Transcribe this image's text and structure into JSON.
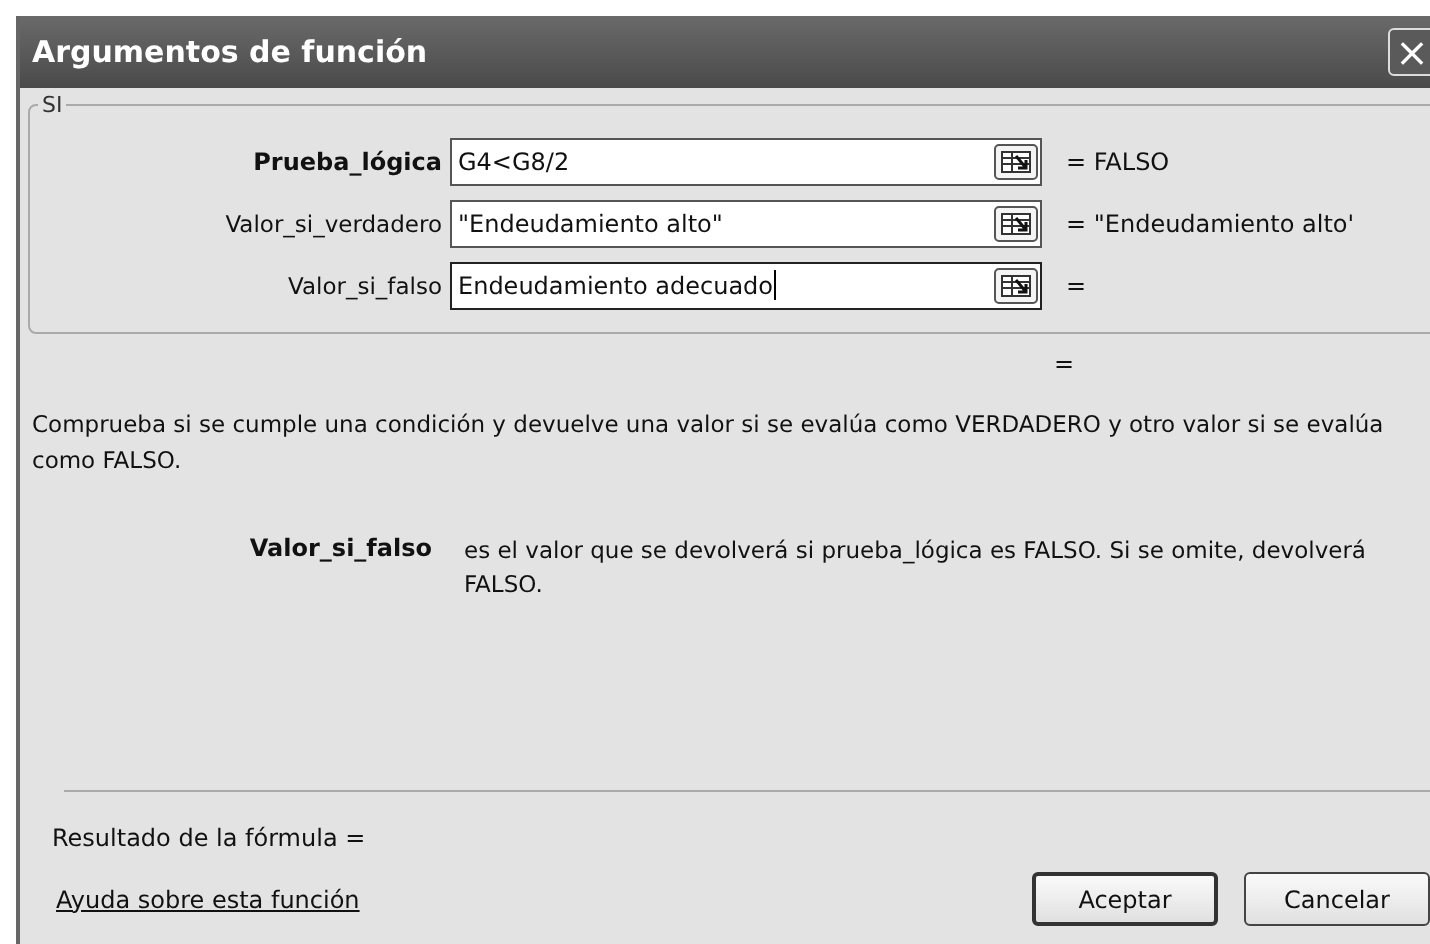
{
  "window": {
    "title": "Argumentos de función",
    "close": "×"
  },
  "group": {
    "title": "SI",
    "arguments": [
      {
        "label": "Prueba_lógica",
        "required": true,
        "value": "G4<G8/2",
        "focused": false,
        "result": "= FALSO"
      },
      {
        "label": "Valor_si_verdadero",
        "required": false,
        "value": "\"Endeudamiento alto\"",
        "focused": false,
        "result": "= \"Endeudamiento alto'"
      },
      {
        "label": "Valor_si_falso",
        "required": false,
        "value": "Endeudamiento adecuado",
        "focused": true,
        "result": "="
      }
    ]
  },
  "function_result": "=",
  "description": "Comprueba si se cumple una condición y devuelve una valor si se evalúa como VERDADERO y otro valor si se evalúa como FALSO.",
  "argument_help": {
    "name": "Valor_si_falso",
    "text": "es el valor que se devolverá si prueba_lógica es FALSO. Si se omite, devolverá FALSO."
  },
  "formula_result": "Resultado de la fórmula =",
  "help_link": "Ayuda sobre esta función",
  "buttons": [
    "Aceptar",
    "Cancelar"
  ]
}
